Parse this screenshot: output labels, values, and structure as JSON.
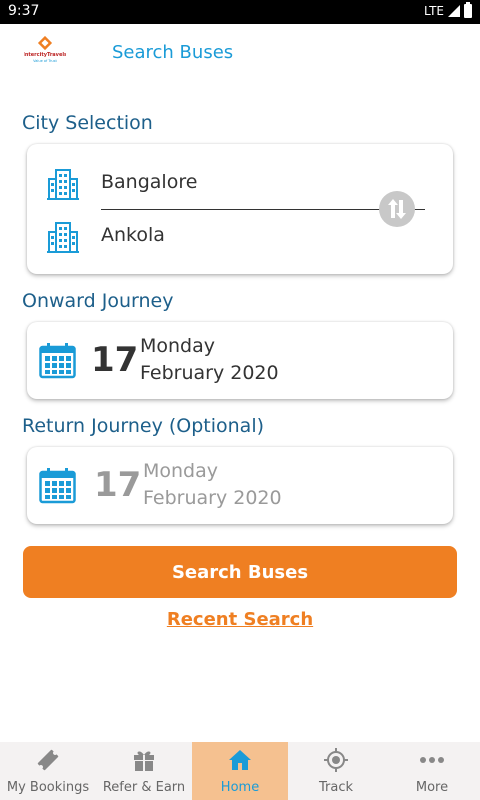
{
  "status_bar": {
    "time": "9:37",
    "network": "LTE"
  },
  "header": {
    "title": "Search Buses",
    "logo_name": "IntercityTravels",
    "logo_tagline": "Value of Trust"
  },
  "city_selection": {
    "label": "City Selection",
    "from": "Bangalore",
    "to": "Ankola"
  },
  "onward": {
    "label": "Onward Journey",
    "day": "17",
    "weekday": "Monday",
    "month_year": "February 2020"
  },
  "return": {
    "label": "Return Journey (Optional)",
    "day": "17",
    "weekday": "Monday",
    "month_year": "February 2020"
  },
  "search_button": "Search Buses",
  "recent_search": "Recent Search",
  "nav": [
    {
      "label": "My Bookings",
      "icon": "ticket-icon"
    },
    {
      "label": "Refer & Earn",
      "icon": "gift-icon"
    },
    {
      "label": "Home",
      "icon": "home-icon"
    },
    {
      "label": "Track",
      "icon": "target-icon"
    },
    {
      "label": "More",
      "icon": "more-dots-icon"
    }
  ],
  "colors": {
    "accent": "#1a9bd7",
    "orange": "#ef7f22",
    "label": "#1d5f8a",
    "active_nav": "#f5c190"
  }
}
